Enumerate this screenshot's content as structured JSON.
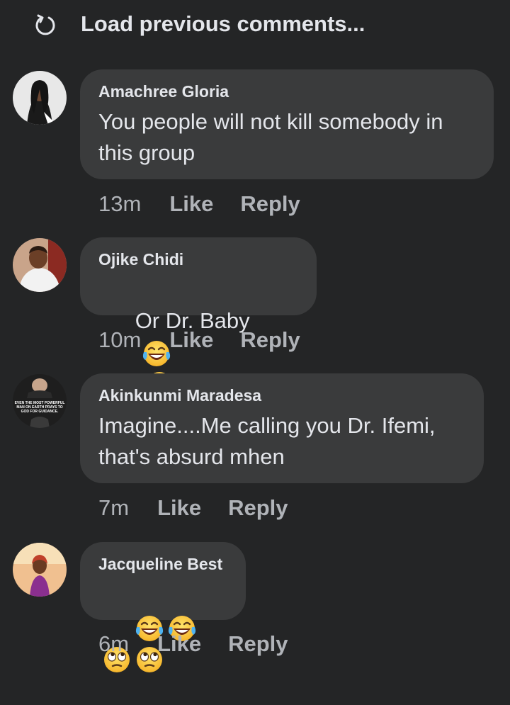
{
  "load_previous": {
    "label": "Load previous comments...",
    "icon": "refresh-icon"
  },
  "colors": {
    "background": "#242526",
    "bubble": "#3a3b3c",
    "text": "#e4e6eb",
    "muted": "#b0b3b8"
  },
  "comments": [
    {
      "author": "Amachree Gloria",
      "text": "You people will not kill somebody in this group",
      "time": "13m",
      "like": "Like",
      "reply": "Reply"
    },
    {
      "author": "Ojike Chidi",
      "text": "Or Dr. Baby",
      "emojis": [
        "laughing-with-tears-emoji",
        "laughing-with-tears-emoji"
      ],
      "time": "10m",
      "like": "Like",
      "reply": "Reply"
    },
    {
      "author": "Akinkunmi Maradesa",
      "text": "Imagine....Me calling you Dr. Ifemi, that's absurd mhen",
      "avatar_caption": "EVEN THE MOST POWERFUL MAN ON EARTH PRAYS TO GOD FOR GUIDANCE.",
      "time": "7m",
      "like": "Like",
      "reply": "Reply"
    },
    {
      "author": "Jacqueline Best",
      "emojis": [
        "laughing-with-tears-emoji",
        "laughing-with-tears-emoji",
        "eye-roll-emoji",
        "eye-roll-emoji"
      ],
      "time": "6m",
      "like": "Like",
      "reply": "Reply"
    }
  ]
}
